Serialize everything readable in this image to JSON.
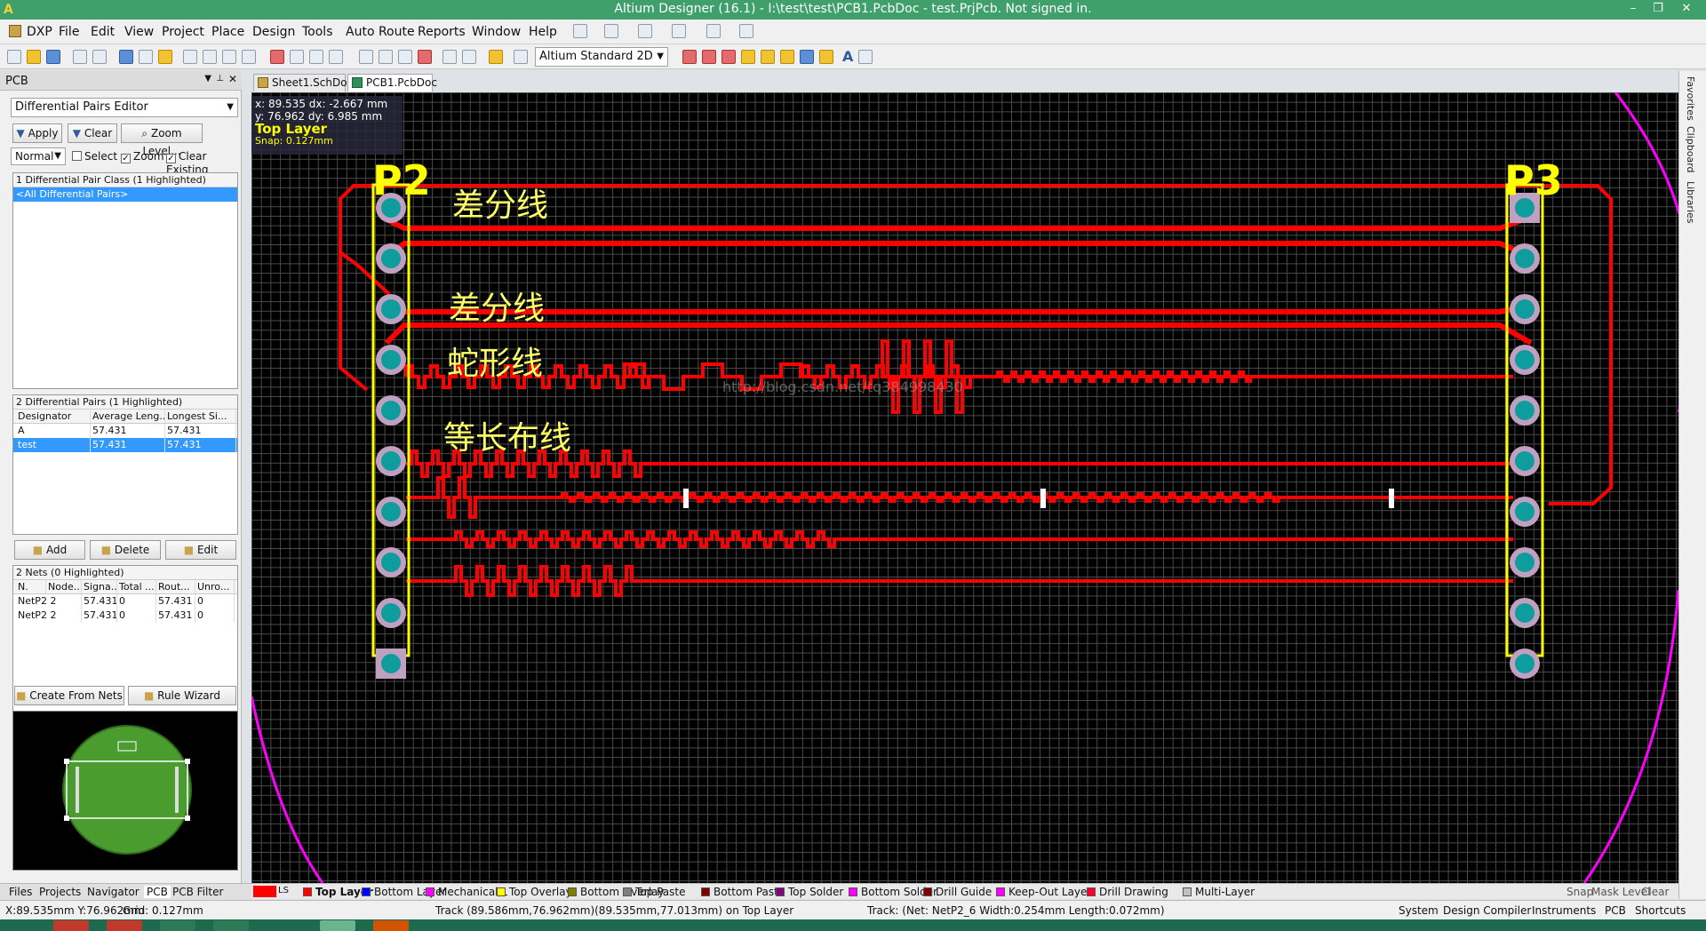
{
  "window": {
    "title": "Altium Designer (16.1) - I:\\test\\test\\PCB1.PcbDoc - test.PrjPcb. Not signed in.",
    "minimize": "–",
    "maximize": "❐",
    "close": "✕"
  },
  "menu": [
    "DXP",
    "File",
    "Edit",
    "View",
    "Project",
    "Place",
    "Design",
    "Tools",
    "Auto Route",
    "Reports",
    "Window",
    "Help"
  ],
  "toolbar": {
    "view_mode": "Altium Standard 2D"
  },
  "panel": {
    "title": "PCB",
    "mode": "Differential Pairs Editor",
    "apply": "Apply",
    "clear": "Clear",
    "zoom_level": "Zoom Level...",
    "filter_mode": "Normal",
    "select": "Select",
    "zoom": "Zoom",
    "clear_existing": "Clear Existing",
    "classes_header": "1 Differential Pair Class (1 Highlighted)",
    "classes": [
      "<All Differential Pairs>"
    ],
    "pairs_header": "2 Differential Pairs (1 Highlighted)",
    "pairs_columns": [
      "Designator",
      "Average Leng...",
      "Longest Si..."
    ],
    "pairs": [
      {
        "designator": "A",
        "average": "57.431",
        "longest": "57.431"
      },
      {
        "designator": "test",
        "average": "57.431",
        "longest": "57.431"
      }
    ],
    "add": "Add",
    "delete": "Delete",
    "edit": "Edit",
    "nets_header": "2 Nets (0 Highlighted)",
    "nets_columns": [
      "N.",
      "Node...",
      "Signa...",
      "Total ...",
      "Rout...",
      "Unro..."
    ],
    "nets": [
      {
        "n": "NetP2 2",
        "node": "",
        "signal": "57.431",
        "total": "0",
        "routed": "57.431",
        "unrouted": "0"
      },
      {
        "n": "NetP2 2",
        "node": "",
        "signal": "57.431",
        "total": "0",
        "routed": "57.431",
        "unrouted": "0"
      }
    ],
    "create_from_nets": "Create From Nets",
    "rule_wizard": "Rule Wizard"
  },
  "doc_tabs": [
    "Sheet1.SchDoc",
    "PCB1.PcbDoc"
  ],
  "pcb": {
    "coord_line1": "x: 89.535   dx: -2.667 mm",
    "coord_line2": "y: 76.962   dy:  6.985  mm",
    "current_layer": "Top Layer",
    "snap": "Snap: 0.127mm",
    "label_p2": "P2",
    "label_p3": "P3",
    "text_diff1": "差分线",
    "text_diff2": "差分线",
    "text_serpentine": "蛇形线",
    "text_equal_length": "等长布线",
    "watermark": "http://blog.csdn.net/tq384998430"
  },
  "right_tabs": [
    "Favorites",
    "Clipboard",
    "Libraries"
  ],
  "layers": [
    {
      "name": "LS",
      "color": "#ff0000"
    },
    {
      "name": "Top Layer",
      "color": "#ff0000"
    },
    {
      "name": "Bottom Layer",
      "color": "#0000ff"
    },
    {
      "name": "Mechanical 1",
      "color": "#ff00ff"
    },
    {
      "name": "Top Overlay",
      "color": "#ffff00"
    },
    {
      "name": "Bottom Overlay",
      "color": "#808000"
    },
    {
      "name": "Top Paste",
      "color": "#808080"
    },
    {
      "name": "Bottom Paste",
      "color": "#800000"
    },
    {
      "name": "Top Solder",
      "color": "#800080"
    },
    {
      "name": "Bottom Solder",
      "color": "#ff00ff"
    },
    {
      "name": "Drill Guide",
      "color": "#800000"
    },
    {
      "name": "Keep-Out Layer",
      "color": "#ff00ff"
    },
    {
      "name": "Drill Drawing",
      "color": "#ff002a"
    },
    {
      "name": "Multi-Layer",
      "color": "#c0c0c0"
    }
  ],
  "layer_right": [
    "Snap",
    "Mask Level",
    "Clear"
  ],
  "panel_tabs": [
    "Files",
    "Projects",
    "Navigator",
    "PCB",
    "PCB Filter"
  ],
  "status": {
    "coords": "X:89.535mm Y:76.962mm",
    "grid": "Grid: 0.127mm",
    "track": "Track (89.586mm,76.962mm)(89.535mm,77.013mm) on Top Layer",
    "track_info": "Track: (Net: NetP2_6 Width:0.254mm Length:0.072mm)",
    "buttons": [
      "System",
      "Design Compiler",
      "Instruments",
      "PCB",
      "Shortcuts"
    ]
  }
}
